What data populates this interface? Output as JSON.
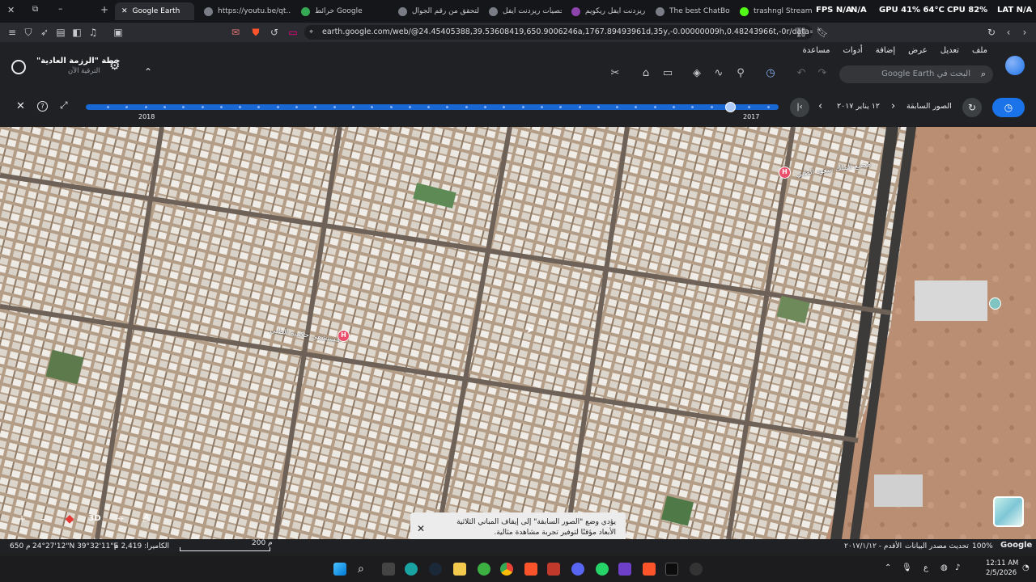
{
  "tabs": [
    {
      "label": "Google Earth",
      "active": true
    },
    {
      "label": "https://youtu.be/qt...",
      "active": false
    },
    {
      "label": "خرائط Google",
      "active": false
    },
    {
      "label": "التحقق من رقم الجوال",
      "active": false
    },
    {
      "label": "شخصيات ريزدنت ايفل",
      "active": false
    },
    {
      "label": "ريزدنت ايفل ريكويم",
      "active": false
    },
    {
      "label": "The best ChatBot an",
      "active": false
    },
    {
      "label": "trashngl Stream - W",
      "active": false
    }
  ],
  "hud": {
    "fps": "FPS N/A",
    "na": "N/A",
    "gpu": "GPU 41% 64°C",
    "cpu": "CPU 82%",
    "lat": "LAT N/A"
  },
  "address": {
    "url": "earth.google.com/web/@24.45405388,39.53608419,650.9006246a,1767.89493961d,35y,-0.00000009h,0.48243966t,-0r/data=ChYqEAgBEgo..."
  },
  "earth": {
    "menus": [
      "ملف",
      "تعديل",
      "عرض",
      "إضافة",
      "أدوات",
      "مساعدة"
    ],
    "project_title": "خطة \"الرزمة العادية\"",
    "project_sub": "الترقية الآن",
    "search_placeholder": "البحث في Google Earth",
    "timeline": {
      "back_label": "الصور السابقة",
      "date": "١٢ يناير ٢٠١٧",
      "year_left": "2018",
      "year_right": "2017",
      "position": 0.93
    }
  },
  "map": {
    "hospital_label_1": "مستشفى حكمية الطبي",
    "hospital_label_2": "مجمع الملك سعود الطبي",
    "toast": "يؤدي وضع \"الصور السابقة\" إلى إيقاف المباني الثلاثية الأبعاد مؤقتًا لتوفير تجربة مشاهدة مثالية.",
    "btn_3d": "3D"
  },
  "status": {
    "google": "Google",
    "zoom": "100%",
    "data_source": "تحديث مصدر البيانات",
    "oldest": "الأقدم - ٢٠١٧/١/١٢",
    "scale": "200 م",
    "camera": "الكاميرا: 2,419 م",
    "coords": "24°27'12\"N 39°32'11\"E",
    "elevation": "650 م"
  },
  "clock": {
    "time": "12:11 AM",
    "date": "2/5/2026"
  },
  "tray": {
    "lang": "ع"
  }
}
